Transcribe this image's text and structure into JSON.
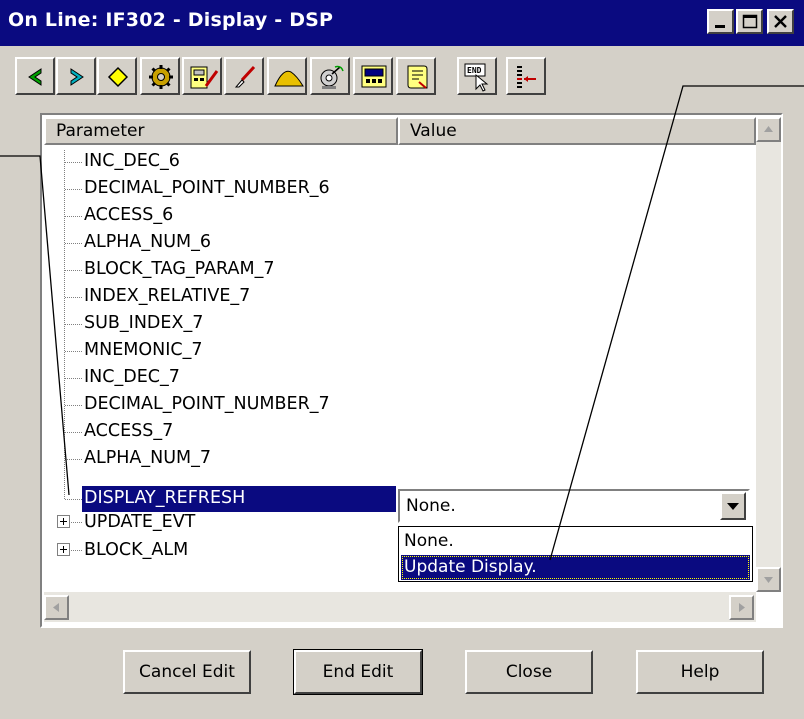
{
  "window": {
    "title": "On Line: IF302 - Display - DSP"
  },
  "titlebar_buttons": {
    "minimize": "minimize-icon",
    "maximize": "maximize-icon",
    "close": "close-icon"
  },
  "toolbar": {
    "tools": [
      "left-arrow-icon",
      "right-arrow-icon",
      "diamond-icon",
      "gear-icon",
      "device-edit-icon",
      "brush-icon",
      "hill-icon",
      "satellite-icon",
      "display-panel-icon",
      "document-icon"
    ],
    "end_label": "END",
    "refresh_icon": "update-list-icon"
  },
  "grid": {
    "headers": {
      "parameter": "Parameter",
      "value": "Value"
    },
    "rows": [
      "INC_DEC_6",
      "DECIMAL_POINT_NUMBER_6",
      "ACCESS_6",
      "ALPHA_NUM_6",
      "BLOCK_TAG_PARAM_7",
      "INDEX_RELATIVE_7",
      "SUB_INDEX_7",
      "MNEMONIC_7",
      "INC_DEC_7",
      "DECIMAL_POINT_NUMBER_7",
      "ACCESS_7",
      "ALPHA_NUM_7",
      "DISPLAY_REFRESH",
      "UPDATE_EVT",
      "BLOCK_ALM"
    ],
    "selected_value": "None.",
    "options": [
      "None.",
      "Update Display."
    ]
  },
  "buttons": {
    "cancel": "Cancel Edit",
    "end": "End Edit",
    "close": "Close",
    "help": "Help"
  },
  "colors": {
    "title_bg": "#0a0a80",
    "selection": "#0a0a80",
    "face": "#d4d0c8"
  }
}
